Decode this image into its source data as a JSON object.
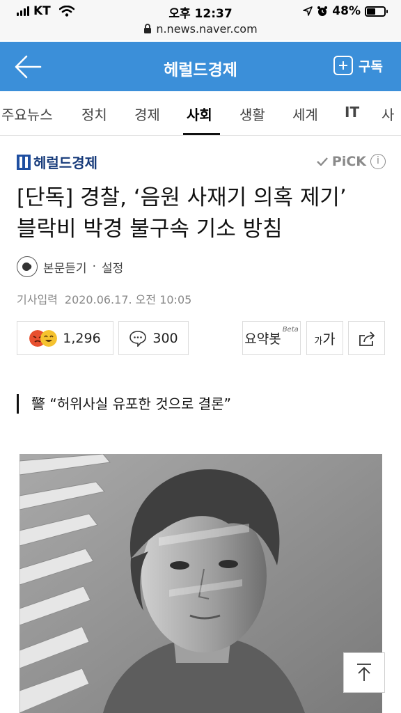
{
  "status_bar": {
    "carrier": "KT",
    "time": "오후 12:37",
    "battery": "48%",
    "battery_level": 0.48
  },
  "url_bar": {
    "url": "n.news.naver.com"
  },
  "header": {
    "brand": "헤럴드경제",
    "subscribe_label": "구독",
    "accent_color": "#3b8fd9"
  },
  "tabs": [
    {
      "label": "주요뉴스"
    },
    {
      "label": "정치"
    },
    {
      "label": "경제"
    },
    {
      "label": "사회"
    },
    {
      "label": "생활"
    },
    {
      "label": "세계"
    },
    {
      "label": "IT"
    },
    {
      "label": "사"
    }
  ],
  "active_tab": "사회",
  "article": {
    "press_name": "헤럴드경제",
    "pick_label": "PiCK",
    "pick_info": "i",
    "headline_line1": "[단독] 경찰, ‘음원 사재기 의혹 제기’",
    "headline_line2": "블락비 박경 불구속 기소 방침",
    "listen_label": "본문듣기",
    "separator": "·",
    "settings_label": "설정",
    "date_label": "기사입력",
    "date_value": "2020.06.17. 오전 10:05",
    "reaction_count": "1,296",
    "comment_count": "300",
    "summary_label": "요약봇",
    "summary_beta": "Beta",
    "font_size_label_small": "가",
    "font_size_label_large": "가",
    "subheadline": "警 “허위사실 유포한 것으로 결론”"
  },
  "icons": {
    "back": "arrow-left-icon",
    "subscribe": "plus-box-icon",
    "pick": "checkmark-icon",
    "listen": "listen-icon",
    "comment": "speech-bubble-icon",
    "share": "share-icon",
    "top": "arrow-up-icon",
    "lock": "lock-icon",
    "wifi": "wifi-icon",
    "location": "location-arrow-icon",
    "alarm": "alarm-icon"
  }
}
